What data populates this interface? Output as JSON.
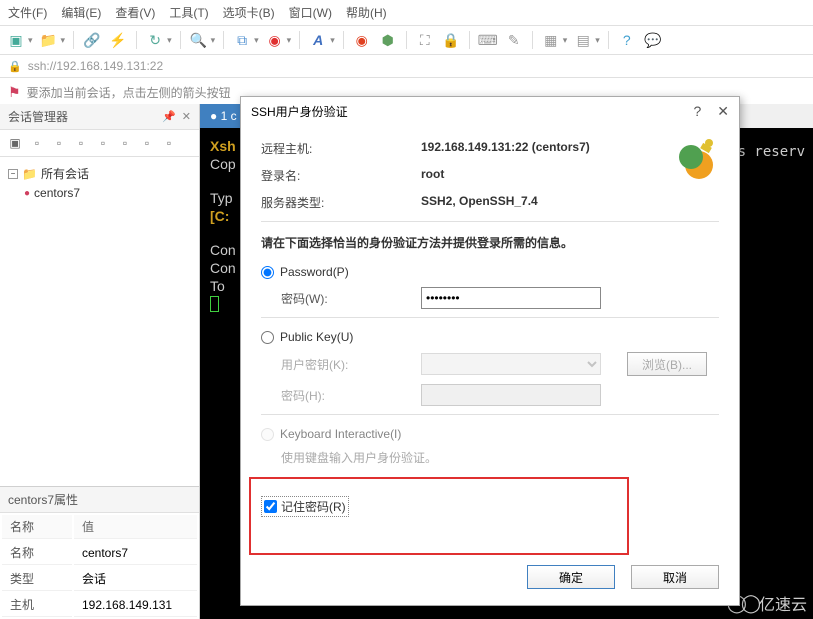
{
  "menu": {
    "file": "文件(F)",
    "edit": "编辑(E)",
    "view": "查看(V)",
    "tools": "工具(T)",
    "tabs": "选项卡(B)",
    "window": "窗口(W)",
    "help": "帮助(H)"
  },
  "addressbar": {
    "url": "ssh://192.168.149.131:22"
  },
  "hint": "要添加当前会话，点击左侧的箭头按钮",
  "session_panel": {
    "title": "会话管理器",
    "root": "所有会话",
    "item": "centors7"
  },
  "props": {
    "title": "centors7属性",
    "col_name": "名称",
    "col_value": "值",
    "rows": [
      {
        "name": "名称",
        "value": "centors7"
      },
      {
        "name": "类型",
        "value": "会话"
      },
      {
        "name": "主机",
        "value": "192.168.149.131"
      }
    ]
  },
  "tab": {
    "active_prefix": "● 1 c"
  },
  "terminal": {
    "l1": "Xsh",
    "l2": "Cop",
    "l3": "Typ",
    "l4": "[C:",
    "l5": "Con",
    "l6": "Con",
    "l7": "To ",
    "right": "s reserv"
  },
  "dialog": {
    "title": "SSH用户身份验证",
    "host_label": "远程主机:",
    "host_value": "192.168.149.131:22 (centors7)",
    "login_label": "登录名:",
    "login_value": "root",
    "server_label": "服务器类型:",
    "server_value": "SSH2, OpenSSH_7.4",
    "prompt": "请在下面选择恰当的身份验证方法并提供登录所需的信息。",
    "opt_password": "Password(P)",
    "pw_label": "密码(W):",
    "pw_value": "••••••••",
    "opt_publickey": "Public Key(U)",
    "pk_user_label": "用户密钥(K):",
    "pk_browse": "浏览(B)...",
    "pk_pw_label": "密码(H):",
    "opt_keyboard": "Keyboard Interactive(I)",
    "keyboard_hint": "使用键盘输入用户身份验证。",
    "remember": "记住密码(R)",
    "ok": "确定",
    "cancel": "取消"
  },
  "watermark": "亿速云"
}
